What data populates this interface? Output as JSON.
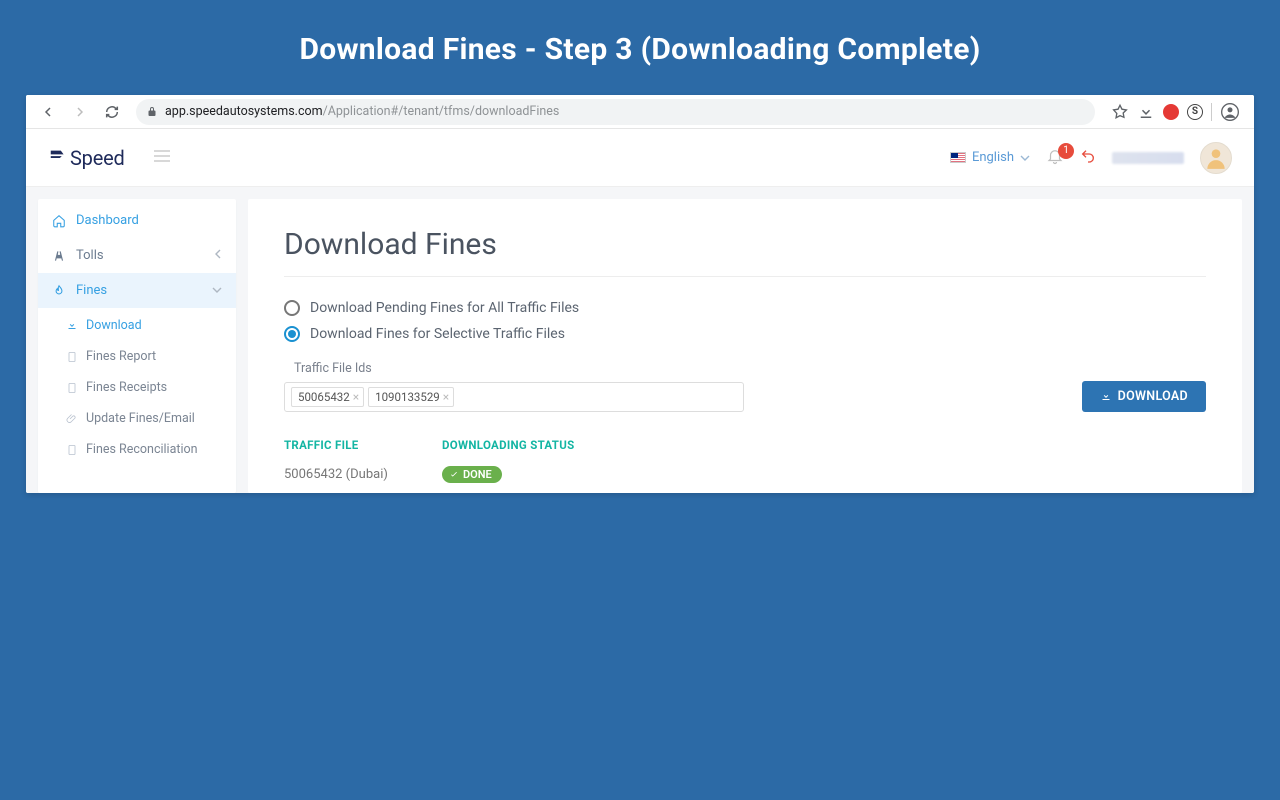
{
  "slide": {
    "title": "Download Fines - Step 3 (Downloading Complete)"
  },
  "browser": {
    "url_domain": "app.speedautosystems.com",
    "url_path": "/Application#/tenant/tfms/downloadFines"
  },
  "header": {
    "brand": "Speed",
    "language": "English",
    "notifications": "1"
  },
  "sidebar": {
    "dashboard": "Dashboard",
    "tolls": "Tolls",
    "fines": "Fines",
    "sub": {
      "download": "Download",
      "report": "Fines Report",
      "receipts": "Fines Receipts",
      "update": "Update Fines/Email",
      "reconciliation": "Fines Reconciliation"
    }
  },
  "page": {
    "title": "Download Fines",
    "radio1": "Download Pending Fines for All Traffic Files",
    "radio2": "Download Fines for Selective Traffic Files",
    "field_label": "Traffic File Ids",
    "tags": {
      "0": "50065432",
      "1": "1090133529"
    },
    "download_btn": "DOWNLOAD",
    "table": {
      "head1": "TRAFFIC FILE",
      "head2": "DOWNLOADING STATUS",
      "row1_file": "50065432 (Dubai)",
      "row1_status": "DONE"
    }
  }
}
